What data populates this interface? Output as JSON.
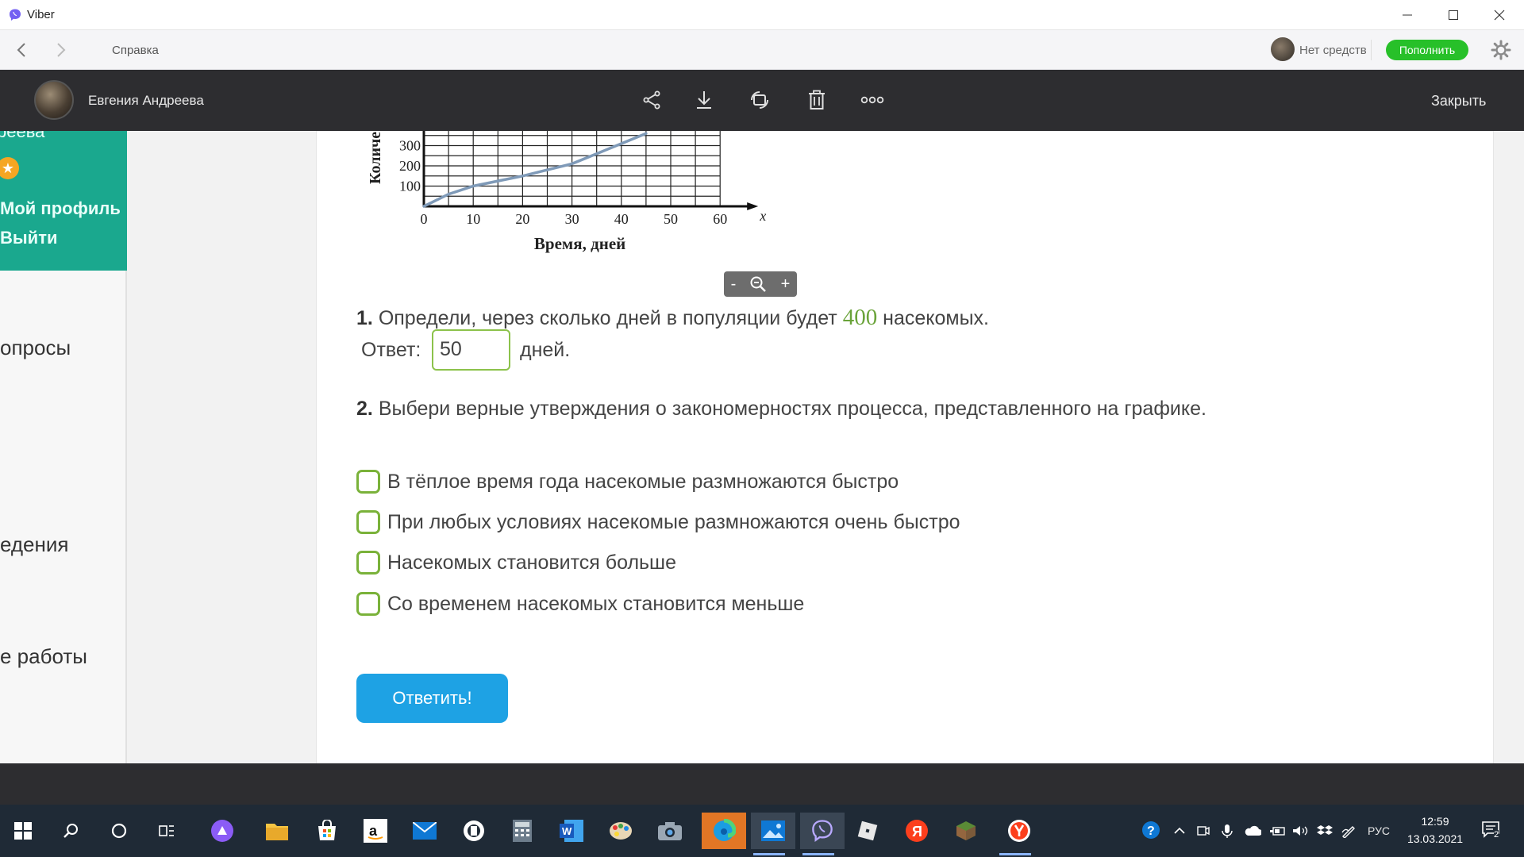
{
  "window": {
    "title": "Viber",
    "controls": [
      "minimize",
      "maximize",
      "close"
    ]
  },
  "toolbar": {
    "help_label": "Справка",
    "balance_text": "Нет средств",
    "topup_label": "Пополнить"
  },
  "viewer": {
    "contact_name": "Евгения Андреева",
    "close_label": "Закрыть",
    "actions": [
      "share-icon",
      "download-icon",
      "rotate-icon",
      "trash-icon",
      "more-icon"
    ]
  },
  "page": {
    "sidebar": {
      "name_fragment": "реева",
      "profile_link": "Мой профиль",
      "logout_link": "Выйти",
      "nav_items": [
        "опросы",
        "едения",
        "е работы"
      ]
    },
    "chart_data": {
      "type": "line",
      "xlabel": "Время, дней",
      "ylabel": "Количе",
      "x_axis_symbol": "x",
      "x_ticks": [
        "0",
        "10",
        "20",
        "30",
        "40",
        "50",
        "60"
      ],
      "y_ticks_visible": [
        "100",
        "200",
        "300"
      ],
      "xlim": [
        0,
        60
      ],
      "grid": true,
      "series": [
        {
          "x": [
            0,
            5,
            10,
            15,
            20,
            25,
            30,
            35,
            40,
            45
          ],
          "y": [
            0,
            60,
            100,
            125,
            150,
            180,
            210,
            260,
            310,
            360
          ]
        }
      ]
    },
    "zoom_controls": {
      "minus": "-",
      "plus": "+"
    },
    "question1": {
      "number": "1.",
      "text_before": "Определи, через сколько дней в популяции будет",
      "value": "400",
      "text_after": "насекомых.",
      "answer_label": "Ответ:",
      "answer_value": "50",
      "answer_unit": "дней."
    },
    "question2": {
      "number": "2.",
      "text": "Выбери верные утверждения о закономерностях процесса, представленного на графике.",
      "options": [
        "В тёплое время года насекомые размножаются быстро",
        "При любых условиях насекомые размножаются очень быстро",
        "Насекомых становится больше",
        "Со временем насекомых становится меньше"
      ]
    },
    "submit_label": "Ответить!"
  },
  "taskbar": {
    "language": "РУС",
    "time": "12:59",
    "date": "13.03.2021",
    "notification_count": "2",
    "icons": [
      "windows-start-icon",
      "search-icon",
      "cortana-icon",
      "task-view-icon",
      "alice-icon",
      "file-explorer-icon",
      "store-icon",
      "amazon-icon",
      "mail-icon",
      "app-icon",
      "calculator-icon",
      "word-icon",
      "paint-icon",
      "camera-icon",
      "edge-icon",
      "photos-icon",
      "viber-icon",
      "roblox-icon",
      "yandex-icon",
      "minecraft-icon",
      "yandex-browser-icon"
    ]
  },
  "colors": {
    "viber_purple": "#7360f2",
    "topup_green": "#27c029",
    "panel_teal": "#1aa88e",
    "checkbox_green": "#7ab23a",
    "submit_blue": "#1ea2e4",
    "chart_line": "#7f9ab8"
  }
}
